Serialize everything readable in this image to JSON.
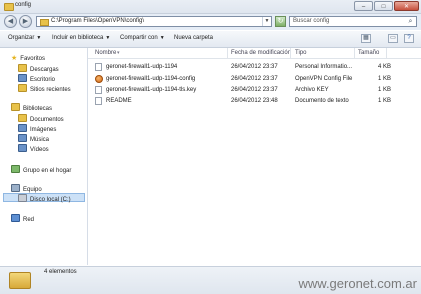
{
  "window": {
    "title": "config",
    "controls": {
      "minimize": "–",
      "maximize": "□",
      "close": "✕"
    }
  },
  "address": {
    "back_glyph": "◀",
    "forward_glyph": "▶",
    "path": "C:\\Program Files\\OpenVPN\\config\\",
    "dropdown_glyph": "▼",
    "refresh_glyph": "↻",
    "search_placeholder": "Buscar config",
    "search_icon": "search-icon"
  },
  "toolbar": {
    "organize": "Organizar",
    "include": "Incluir en biblioteca",
    "share": "Compartir con",
    "new_folder": "Nueva carpeta",
    "caret": "▼",
    "views_glyph": "▦",
    "preview_glyph": "▭",
    "help_glyph": "?"
  },
  "sidebar": {
    "favorites": "Favoritos",
    "downloads": "Descargas",
    "desktop": "Escritorio",
    "recent": "Sitios recientes",
    "libraries": "Bibliotecas",
    "documents": "Documentos",
    "images": "Imágenes",
    "music": "Música",
    "videos": "Vídeos",
    "homegroup": "Grupo en el hogar",
    "computer": "Equipo",
    "local_disk": "Disco local (C:)",
    "network": "Red"
  },
  "columns": {
    "name": "Nombre",
    "modified": "Fecha de modificación",
    "type": "Tipo",
    "size": "Tamaño"
  },
  "files": [
    {
      "name": "geronet-firewall1-udp-1194",
      "modified": "26/04/2012 23:37",
      "type": "Personal Informatio...",
      "size": "4 KB"
    },
    {
      "name": "geronet-firewall1-udp-1194-config",
      "modified": "26/04/2012 23:37",
      "type": "OpenVPN Config File",
      "size": "1 KB"
    },
    {
      "name": "geronet-firewall1-udp-1194-tls.key",
      "modified": "26/04/2012 23:37",
      "type": "Archivo KEY",
      "size": "1 KB"
    },
    {
      "name": "README",
      "modified": "26/04/2012 23:48",
      "type": "Documento de texto",
      "size": "1 KB"
    }
  ],
  "status": {
    "count": "4 elementos"
  },
  "watermark": "www.geronet.com.ar"
}
